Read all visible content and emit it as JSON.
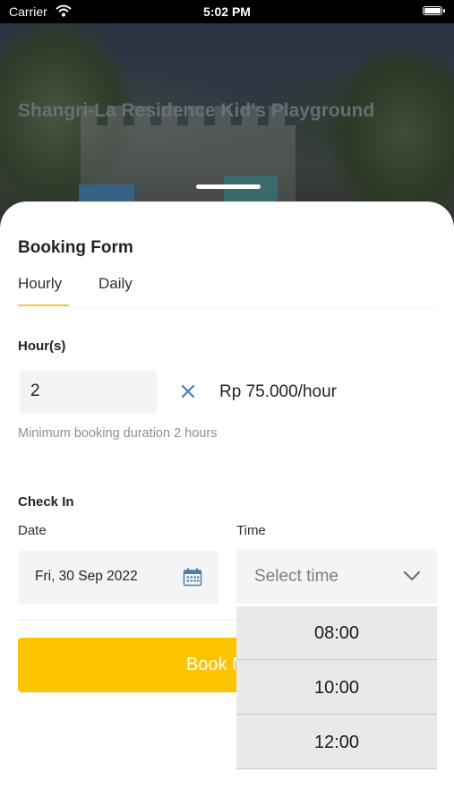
{
  "status_bar": {
    "carrier": "Carrier",
    "time": "5:02 PM"
  },
  "hero": {
    "title": "Shangri-La Residence Kid's Playground"
  },
  "form": {
    "title": "Booking Form",
    "tabs": [
      {
        "label": "Hourly",
        "selected": true
      },
      {
        "label": "Daily",
        "selected": false
      }
    ],
    "hours_label": "Hour(s)",
    "hours_value": "2",
    "price": "Rp 75.000/hour",
    "hint": "Minimum booking duration 2 hours",
    "checkin_label": "Check In",
    "date_label": "Date",
    "date_value": "Fri, 30 Sep 2022",
    "time_label": "Time",
    "time_placeholder": "Select time",
    "book_label": "Book Now"
  },
  "time_options": [
    "08:00",
    "10:00",
    "12:00"
  ],
  "colors": {
    "accent": "#ffc400",
    "tab_indicator": "#f6c344",
    "icon_blue": "#4a7fb0"
  },
  "icons": [
    "wifi-icon",
    "battery-icon",
    "times-icon",
    "calendar-icon",
    "chevron-down-icon"
  ]
}
